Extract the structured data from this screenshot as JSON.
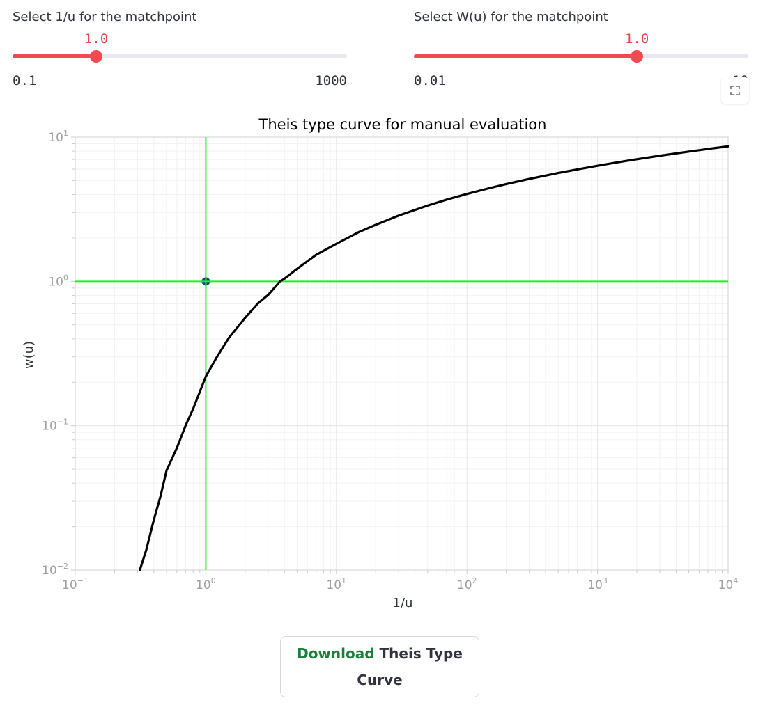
{
  "slider_u": {
    "label": "Select 1/u for the matchpoint",
    "value": "1.0",
    "min": "0.1",
    "max": "1000",
    "fraction": 0.25
  },
  "slider_w": {
    "label": "Select W(u) for the matchpoint",
    "value": "1.0",
    "min": "0.01",
    "max": "10",
    "fraction": 0.667
  },
  "expand_icon": "fullscreen-icon",
  "colors": {
    "accent": "#ef4b50",
    "curve": "#000000",
    "crosshair": "#22ee22",
    "matchpoint": "#1f3a93",
    "download_word": "#1b7f3b"
  },
  "chart_data": {
    "type": "line",
    "title": "Theis type curve for manual evaluation",
    "xlabel": "1/u",
    "ylabel": "w(u)",
    "x_scale": "log",
    "y_scale": "log",
    "xlim": [
      0.1,
      10000
    ],
    "ylim": [
      0.01,
      10
    ],
    "xticks": [
      {
        "base": "10",
        "exp": "−1"
      },
      {
        "base": "10",
        "exp": "0"
      },
      {
        "base": "10",
        "exp": "1"
      },
      {
        "base": "10",
        "exp": "2"
      },
      {
        "base": "10",
        "exp": "3"
      },
      {
        "base": "10",
        "exp": "4"
      }
    ],
    "yticks": [
      {
        "base": "10",
        "exp": "−2"
      },
      {
        "base": "10",
        "exp": "−1"
      },
      {
        "base": "10",
        "exp": "0"
      },
      {
        "base": "10",
        "exp": "1"
      }
    ],
    "grid": true,
    "series": [
      {
        "x": [
          0.3125,
          0.35,
          0.4,
          0.45,
          0.5,
          0.6,
          0.7,
          0.8,
          1.0,
          1.2,
          1.5,
          2,
          2.5,
          3,
          3.7,
          4,
          5,
          7,
          10,
          15,
          20,
          30,
          50,
          70,
          100,
          150,
          200,
          300,
          500,
          700,
          1000,
          1500,
          2000,
          3000,
          5000,
          7000,
          10000
        ],
        "y": [
          0.01,
          0.0138,
          0.0223,
          0.0325,
          0.0489,
          0.0701,
          0.1003,
          0.1311,
          0.2194,
          0.2938,
          0.4058,
          0.5598,
          0.7024,
          0.8057,
          1.0,
          1.0443,
          1.2227,
          1.5291,
          1.8229,
          2.2073,
          2.4678,
          2.8584,
          3.3547,
          3.6879,
          4.0379,
          4.4392,
          4.7261,
          5.129,
          5.6393,
          5.9741,
          6.3315,
          6.7362,
          7.0239,
          7.429,
          7.939,
          8.275,
          8.6332
        ]
      }
    ],
    "crosshair": {
      "x": 1.0,
      "y": 1.0
    }
  },
  "download": {
    "word": "Download",
    "rest_line1": "Theis Type",
    "rest_line2": "Curve"
  }
}
